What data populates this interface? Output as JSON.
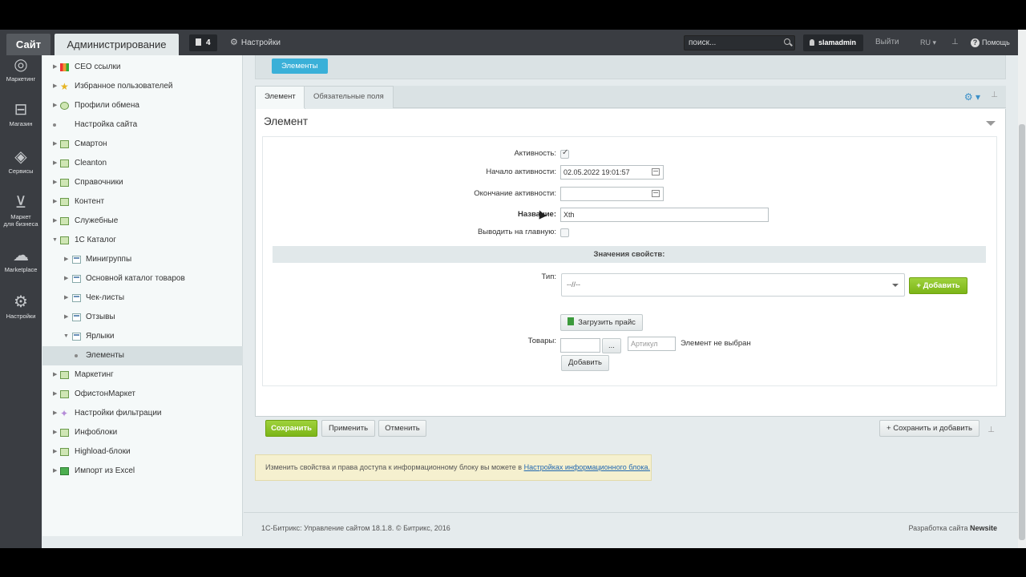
{
  "topbar": {
    "site_tab": "Сайт",
    "admin_tab": "Администрирование",
    "notifications_count": "4",
    "settings_label": "Настройки",
    "search_placeholder": "поиск...",
    "username": "slamadmin",
    "logout": "Выйти",
    "language": "RU",
    "help": "Помощь"
  },
  "iconbar": {
    "items": [
      {
        "label": "Маркетинг",
        "icon": "target-icon"
      },
      {
        "label": "Магазин",
        "icon": "basket-icon"
      },
      {
        "label": "Сервисы",
        "icon": "layers-icon"
      },
      {
        "label": "Маркет",
        "label2": "для бизнеса",
        "icon": "cart-icon"
      },
      {
        "label": "Marketplace",
        "icon": "cloud-download-icon"
      },
      {
        "label": "Настройки",
        "icon": "gear-icon"
      }
    ]
  },
  "tree": {
    "items": [
      {
        "label": "СЕО ссылки"
      },
      {
        "label": "Избранное пользователей"
      },
      {
        "label": "Профили обмена"
      },
      {
        "label": "Настройка сайта"
      },
      {
        "label": "Смартон"
      },
      {
        "label": "Cleanton"
      },
      {
        "label": "Справочники"
      },
      {
        "label": "Контент"
      },
      {
        "label": "Служебные"
      },
      {
        "label": "1С Каталог"
      },
      {
        "label": "Минигруппы"
      },
      {
        "label": "Основной каталог товаров"
      },
      {
        "label": "Чек-листы"
      },
      {
        "label": "Отзывы"
      },
      {
        "label": "Ярлыки"
      },
      {
        "label": "Элементы"
      },
      {
        "label": "Маркетинг"
      },
      {
        "label": "ОфистонМаркет"
      },
      {
        "label": "Настройки фильтрации"
      },
      {
        "label": "Инфоблоки"
      },
      {
        "label": "Highload-блоки"
      },
      {
        "label": "Импорт из Excel"
      }
    ]
  },
  "breadcrumb": "Элементы",
  "tabs": [
    "Элемент",
    "Обязательные поля"
  ],
  "form": {
    "title": "Элемент",
    "active_label": "Активность:",
    "active_checked": true,
    "start_label": "Начало активности:",
    "start_value": "02.05.2022 19:01:57",
    "end_label": "Окончание активности:",
    "end_value": "",
    "name_label": "Название:",
    "name_value": "Xth",
    "main_label": "Выводить на главную:",
    "props_header": "Значения свойств:",
    "type_label": "Тип:",
    "type_value": "--//--",
    "add_button": "Добавить",
    "upload_button": "Загрузить прайс",
    "goods_label": "Товары:",
    "goods_value": "",
    "ellipsis_button": "...",
    "article_placeholder": "Артикул",
    "no_element": "Элемент не выбран",
    "add_button2": "Добавить"
  },
  "actions": {
    "save": "Сохранить",
    "apply": "Применить",
    "cancel": "Отменить",
    "save_add": "Сохранить и добавить"
  },
  "note": {
    "text": "Изменить свойства и права доступа к информационному блоку вы можете в ",
    "link": "Настройках информационного блока."
  },
  "footer": {
    "left": "1С-Битрикс: Управление сайтом 18.1.8. © Битрикс, 2016",
    "right_prefix": "Разработка сайта ",
    "right_brand": "Newsite"
  },
  "colors": {
    "accent_green": "#7cb518",
    "breadcrumb_blue": "#3ab0d8",
    "topbar": "#3a3d42"
  }
}
